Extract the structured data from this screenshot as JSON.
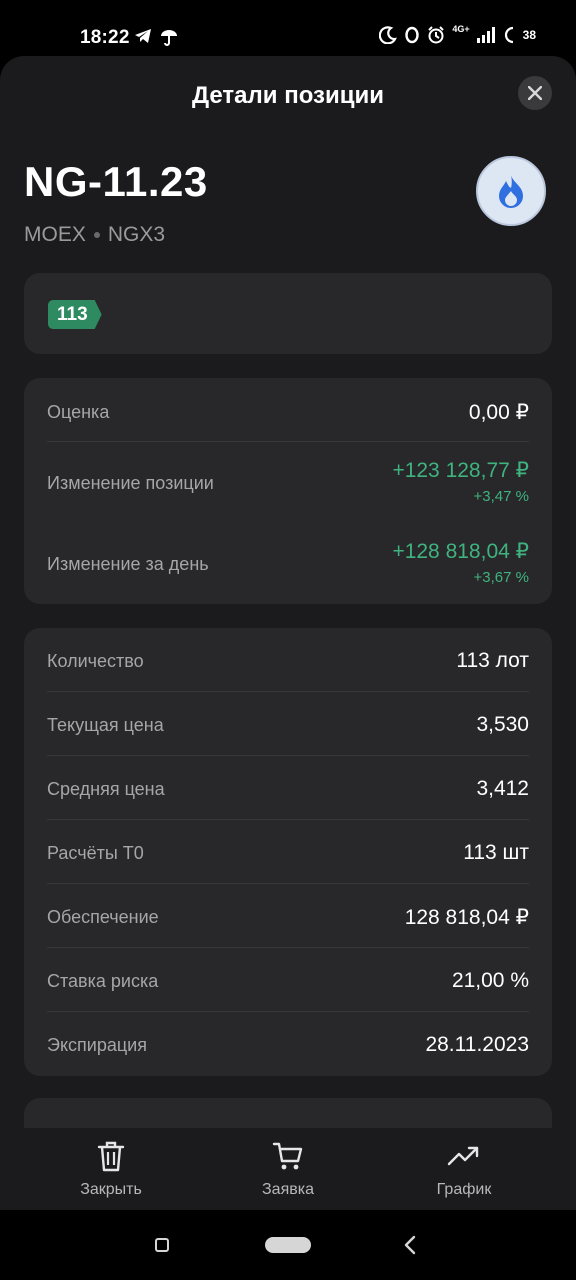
{
  "status_bar": {
    "time": "18:22",
    "network": "4G+",
    "battery": "38"
  },
  "header": {
    "title": "Детали позиции"
  },
  "instrument": {
    "ticker": "NG-11.23",
    "exchange": "MOEX",
    "code": "NGX3",
    "logo_icon": "flame-icon"
  },
  "tag": {
    "quantity": "113"
  },
  "valuation": {
    "rows": [
      {
        "label": "Оценка",
        "value": "0,00 ₽"
      },
      {
        "label": "Изменение позиции",
        "value": "+123 128,77 ₽",
        "sub": "+3,47 %"
      },
      {
        "label": "Изменение за день",
        "value": "+128 818,04 ₽",
        "sub": "+3,67 %"
      }
    ]
  },
  "details": {
    "rows": [
      {
        "label": "Количество",
        "value": "113 лот"
      },
      {
        "label": "Текущая цена",
        "value": "3,530"
      },
      {
        "label": "Средняя цена",
        "value": "3,412"
      },
      {
        "label": "Расчёты T0",
        "value": "113 шт"
      },
      {
        "label": "Обеспечение",
        "value": "128 818,04 ₽"
      },
      {
        "label": "Ставка риска",
        "value": "21,00 %"
      },
      {
        "label": "Экспирация",
        "value": "28.11.2023"
      }
    ]
  },
  "actions": {
    "close_label": "Закрыть",
    "order_label": "Заявка",
    "chart_label": "График"
  },
  "colors": {
    "background": "#1b1b1d",
    "card": "#28282b",
    "positive": "#3fb37f",
    "badge": "#2e8b61"
  }
}
